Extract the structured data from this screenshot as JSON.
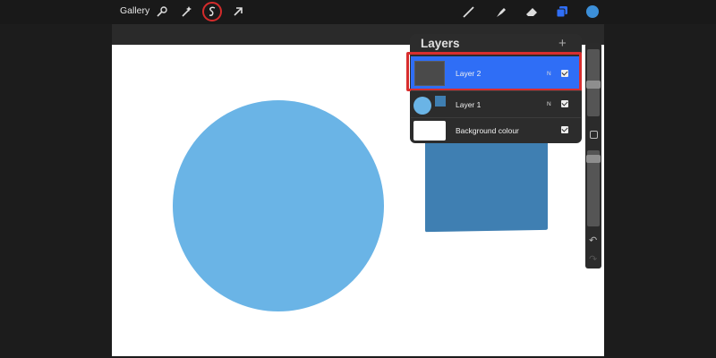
{
  "toolbar": {
    "gallery_label": "Gallery",
    "left_tools": [
      "wrench-icon",
      "magic-wand-icon",
      "selection-icon",
      "transform-arrow-icon"
    ],
    "right_tools": [
      "brush-icon",
      "smudge-icon",
      "eraser-icon",
      "layers-icon",
      "color-icon"
    ],
    "highlighted_tool": "selection-icon",
    "active_color": "#3c8fd8"
  },
  "layers_panel": {
    "title": "Layers",
    "add_label": "+",
    "rows": [
      {
        "name": "Layer 2",
        "mode": "N",
        "visible": true,
        "active": true
      },
      {
        "name": "Layer 1",
        "mode": "N",
        "visible": true,
        "active": false
      },
      {
        "name": "Background colour",
        "mode": "",
        "visible": true,
        "active": false
      }
    ]
  },
  "sidebar": {
    "undo_icon": "undo-icon",
    "redo_icon": "redo-icon"
  },
  "colors": {
    "canvas": "#ffffff",
    "circle": "#6ab4e6",
    "square": "#3f7fb2",
    "accent": "#2f6ef6",
    "highlight": "#d82e2e"
  }
}
